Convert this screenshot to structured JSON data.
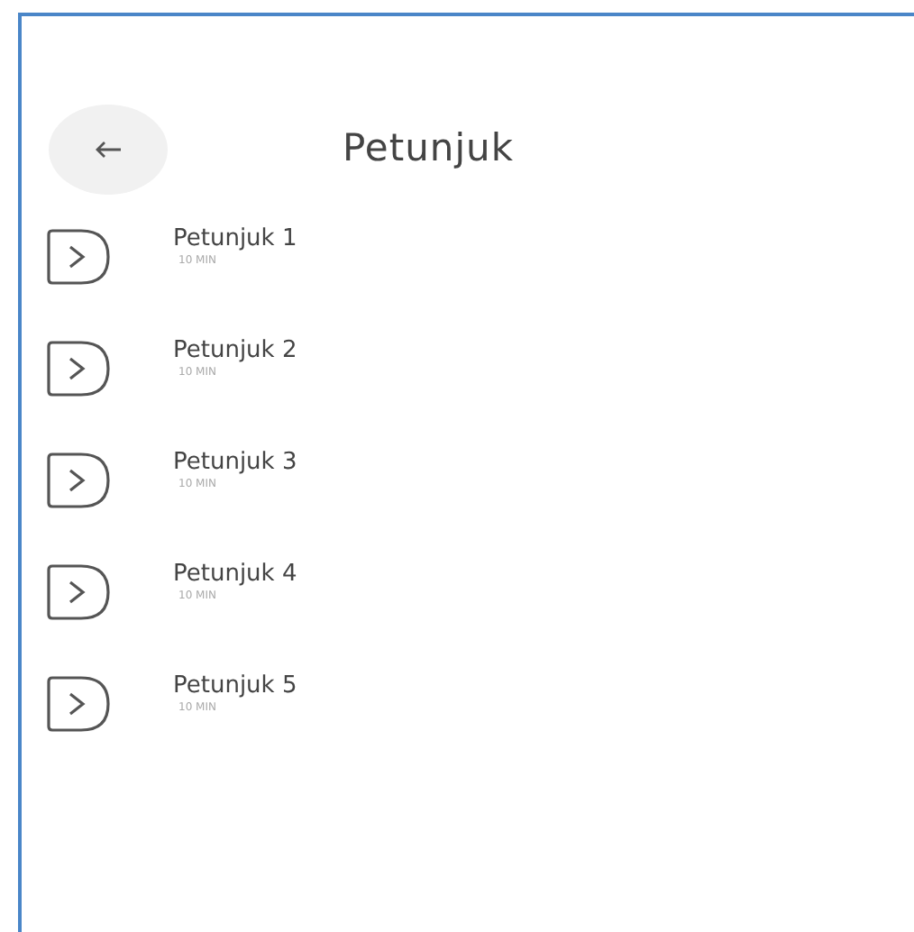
{
  "header": {
    "title": "Petunjuk"
  },
  "items": [
    {
      "title": "Petunjuk 1",
      "duration": "10 MIN"
    },
    {
      "title": "Petunjuk 2",
      "duration": "10 MIN"
    },
    {
      "title": "Petunjuk 3",
      "duration": "10 MIN"
    },
    {
      "title": "Petunjuk 4",
      "duration": "10 MIN"
    },
    {
      "title": "Petunjuk 5",
      "duration": "10 MIN"
    }
  ]
}
